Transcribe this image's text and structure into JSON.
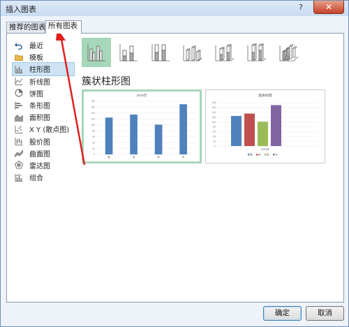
{
  "window": {
    "title": "插入图表",
    "help": "?",
    "close": "✕"
  },
  "tabs": [
    {
      "label": "推荐的图表",
      "active": false
    },
    {
      "label": "所有图表",
      "active": true
    }
  ],
  "sidebar": {
    "items": [
      {
        "label": "最近",
        "icon": "undo-icon",
        "selected": false
      },
      {
        "label": "模板",
        "icon": "folder-icon",
        "selected": false
      },
      {
        "label": "柱形图",
        "icon": "column-chart-icon",
        "selected": true
      },
      {
        "label": "折线图",
        "icon": "line-chart-icon",
        "selected": false
      },
      {
        "label": "饼图",
        "icon": "pie-chart-icon",
        "selected": false
      },
      {
        "label": "条形图",
        "icon": "bar-chart-icon",
        "selected": false
      },
      {
        "label": "面积图",
        "icon": "area-chart-icon",
        "selected": false
      },
      {
        "label": "X Y (散点图)",
        "icon": "scatter-chart-icon",
        "selected": false
      },
      {
        "label": "股价图",
        "icon": "stock-chart-icon",
        "selected": false
      },
      {
        "label": "曲面图",
        "icon": "surface-chart-icon",
        "selected": false
      },
      {
        "label": "雷达图",
        "icon": "radar-chart-icon",
        "selected": false
      },
      {
        "label": "组合",
        "icon": "combo-chart-icon",
        "selected": false
      }
    ]
  },
  "subtypes": [
    {
      "name": "clustered-column",
      "selected": true
    },
    {
      "name": "stacked-column",
      "selected": false
    },
    {
      "name": "100-stacked-column",
      "selected": false
    },
    {
      "name": "3d-clustered-column",
      "selected": false
    },
    {
      "name": "3d-stacked-column",
      "selected": false
    },
    {
      "name": "3d-100-stacked-column",
      "selected": false
    },
    {
      "name": "3d-column",
      "selected": false
    }
  ],
  "section_title": "簇状柱形图",
  "colors": {
    "accent_green": "#a6d7ba",
    "bar_blue": "#4f81bd",
    "bar_red": "#c0504d",
    "bar_green": "#9bbb59",
    "bar_purple": "#8064a2",
    "arrow_red": "#e02020"
  },
  "previews": {
    "first": {
      "title": "2010年",
      "y_ticks": [
        "180",
        "160",
        "140",
        "120",
        "100",
        "80",
        "60",
        "40",
        "20",
        "0"
      ],
      "categories": [
        "春",
        "夏",
        "秋",
        "冬"
      ],
      "values": [
        125,
        135,
        101,
        170
      ]
    },
    "second": {
      "title": "图表标题",
      "y_ticks": [
        "180",
        "160",
        "140",
        "120",
        "100",
        "80",
        "60",
        "40",
        "20",
        "0"
      ],
      "xlabel": "2010年",
      "series": [
        {
          "name": "春",
          "value": 125
        },
        {
          "name": "夏",
          "value": 135
        },
        {
          "name": "秋",
          "value": 101
        },
        {
          "name": "冬",
          "value": 170
        }
      ]
    }
  },
  "buttons": {
    "ok": "确定",
    "cancel": "取消"
  }
}
